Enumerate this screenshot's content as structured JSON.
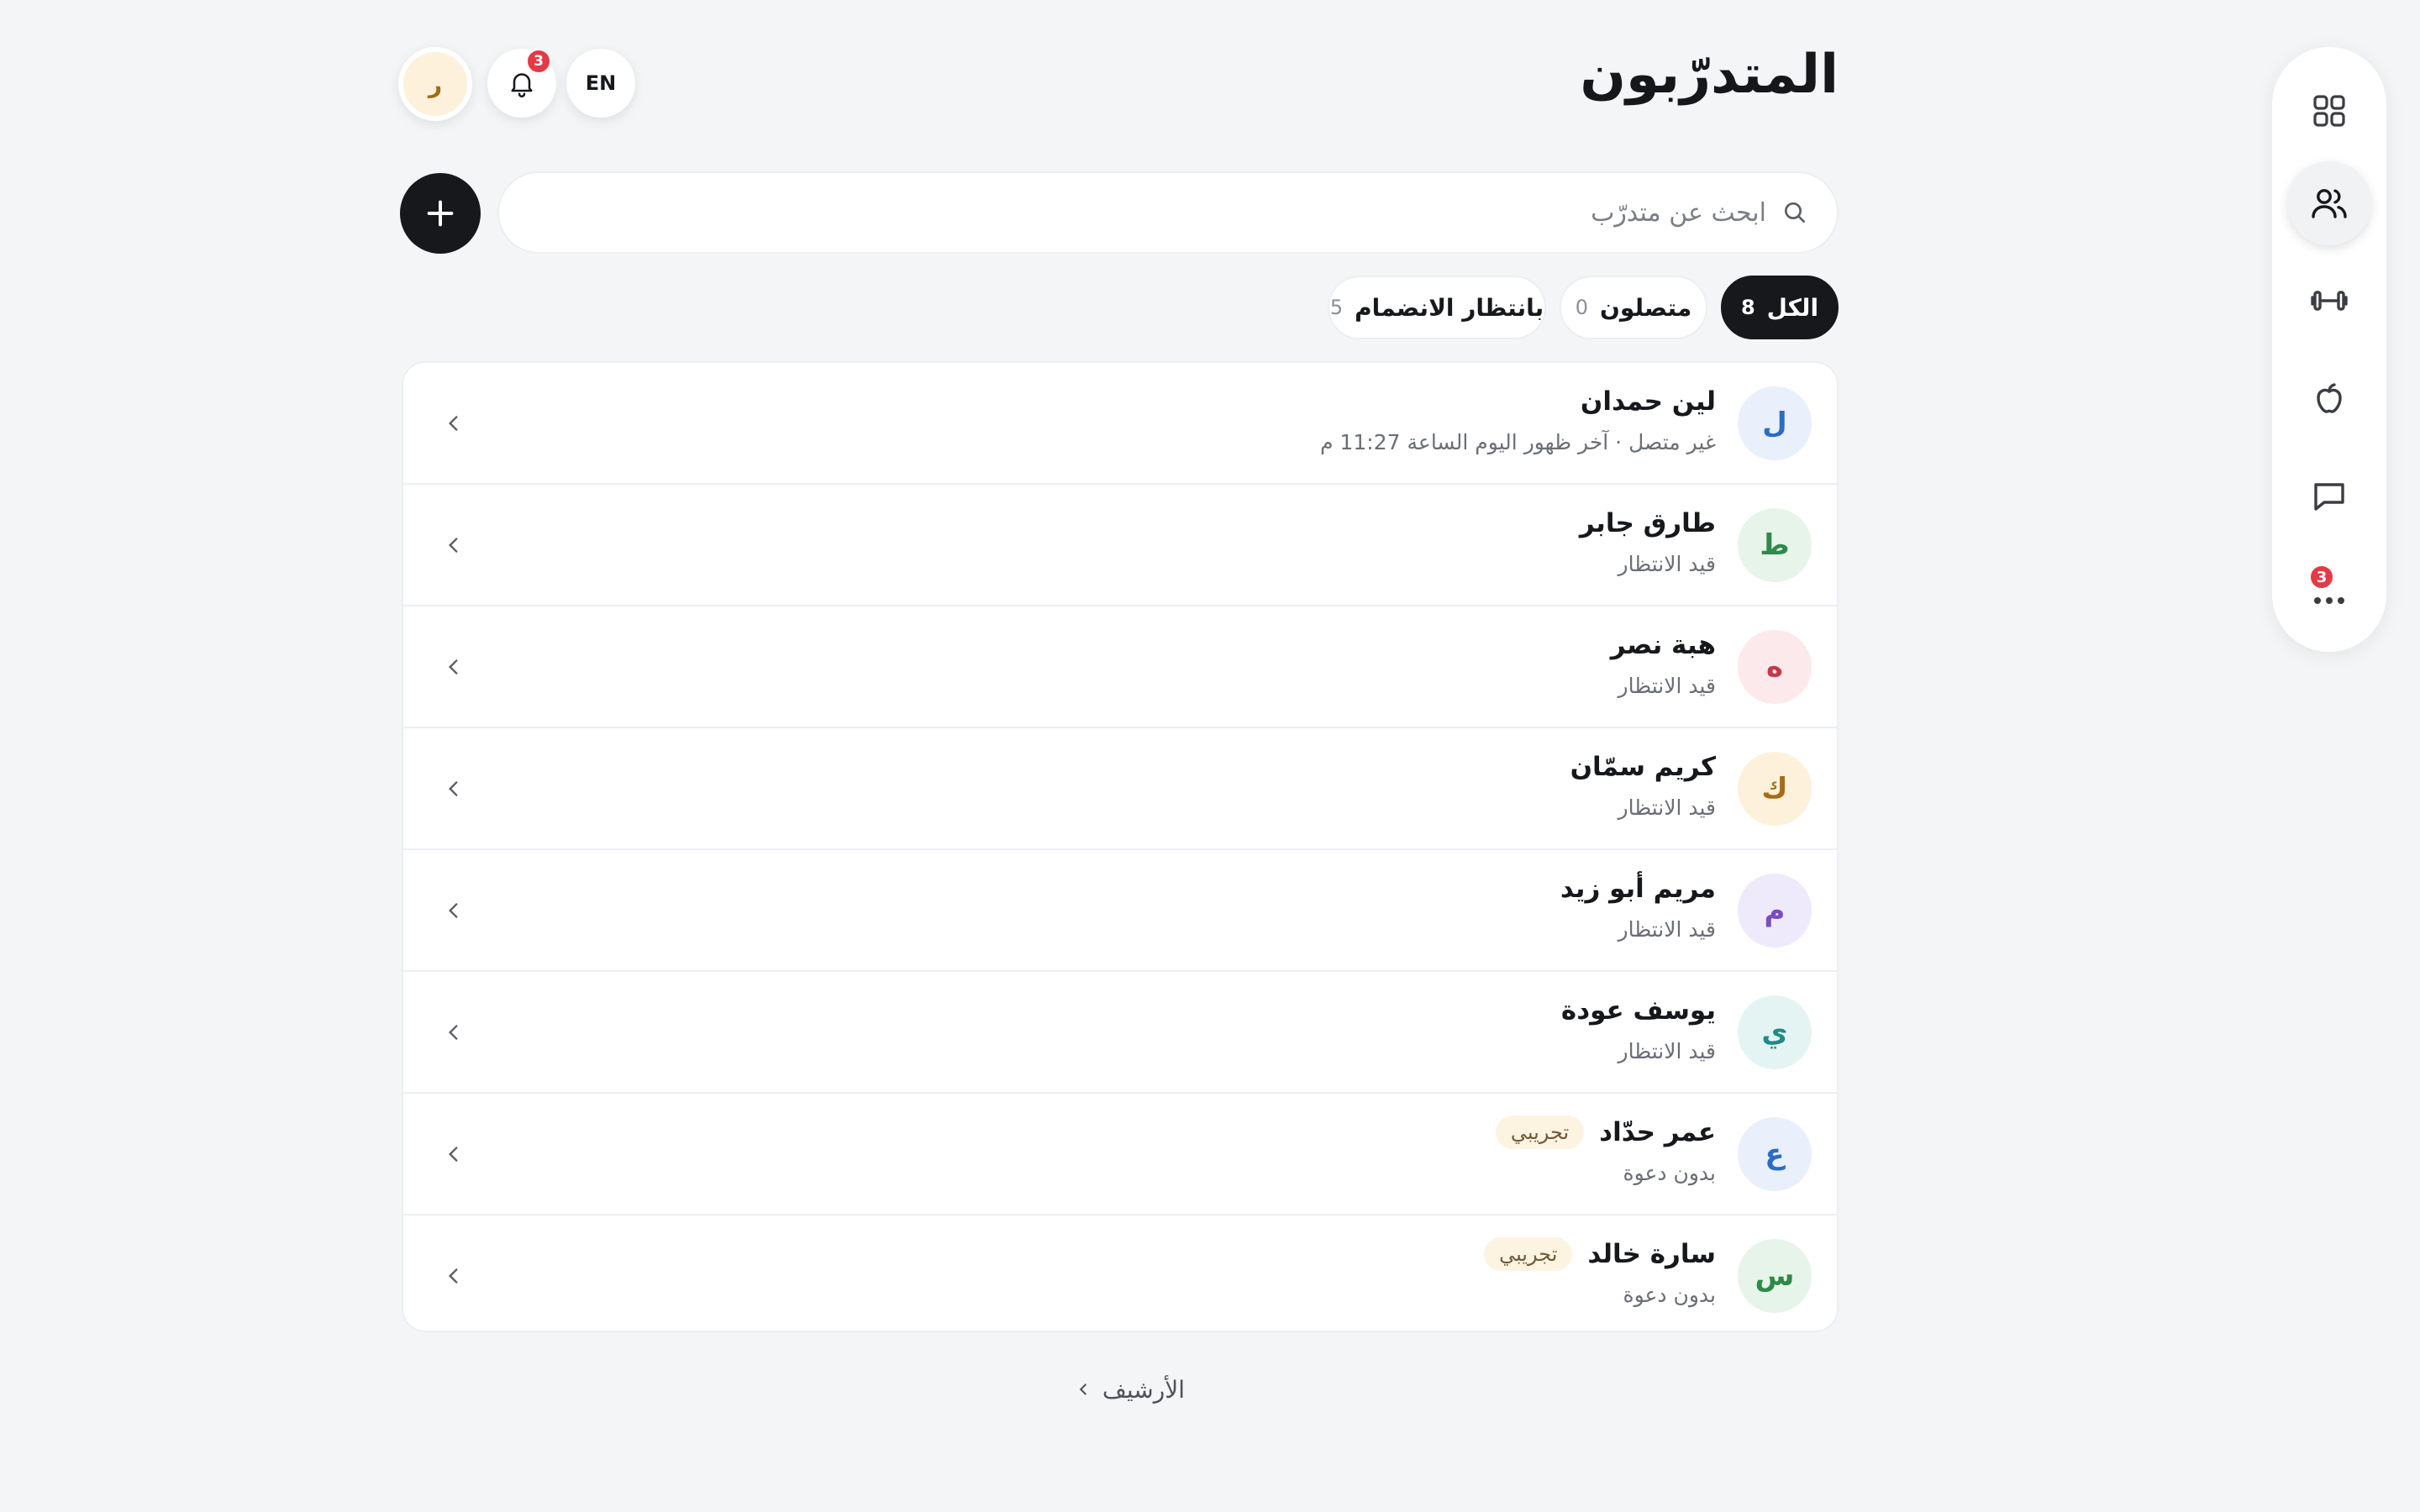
{
  "header": {
    "title": "المتدرّبون",
    "language_label": "EN",
    "notifications_count": "3",
    "avatar_initial": "ر"
  },
  "search": {
    "placeholder": "ابحث عن متدرّب",
    "value": ""
  },
  "filters": [
    {
      "label": "الكل",
      "count": "8",
      "active": true
    },
    {
      "label": "متصلون",
      "count": "0",
      "active": false
    },
    {
      "label": "بانتظار الانضمام",
      "count": "5",
      "active": false
    }
  ],
  "trainees": [
    {
      "initial": "ل",
      "name": "لين حمدان",
      "status": "غير متصل · آخر ظهور اليوم الساعة 11:27 م",
      "tag": "",
      "color": "#2b6cc4",
      "bg": "#e9effb"
    },
    {
      "initial": "ط",
      "name": "طارق جابر",
      "status": "قيد الانتظار",
      "tag": "",
      "color": "#2e8a4a",
      "bg": "#e6f4ea"
    },
    {
      "initial": "ه",
      "name": "هبة نصر",
      "status": "قيد الانتظار",
      "tag": "",
      "color": "#c23a4a",
      "bg": "#fbe9eb"
    },
    {
      "initial": "ك",
      "name": "كريم سمّان",
      "status": "قيد الانتظار",
      "tag": "",
      "color": "#a86b16",
      "bg": "#fdf1dc"
    },
    {
      "initial": "م",
      "name": "مريم أبو زيد",
      "status": "قيد الانتظار",
      "tag": "",
      "color": "#7a4cc2",
      "bg": "#efeafb"
    },
    {
      "initial": "ي",
      "name": "يوسف عودة",
      "status": "قيد الانتظار",
      "tag": "",
      "color": "#1f8a86",
      "bg": "#e4f4f2"
    },
    {
      "initial": "ع",
      "name": "عمر حدّاد",
      "status": "بدون دعوة",
      "tag": "تجريبي",
      "color": "#2b6cc4",
      "bg": "#e9effb"
    },
    {
      "initial": "س",
      "name": "سارة خالد",
      "status": "بدون دعوة",
      "tag": "تجريبي",
      "color": "#2e8a4a",
      "bg": "#e6f4ea"
    }
  ],
  "archive": {
    "label": "الأرشيف"
  },
  "rail": {
    "items": [
      {
        "icon": "dashboard-grid-icon"
      },
      {
        "icon": "users-icon",
        "active": true
      },
      {
        "icon": "dumbbell-icon"
      },
      {
        "icon": "apple-icon"
      },
      {
        "icon": "chat-bubble-icon"
      },
      {
        "icon": "more-icon",
        "badge": "3"
      }
    ]
  },
  "colors": {
    "background": "#f4f5f7",
    "primary_dark": "#16181c",
    "badge_red": "#e53945",
    "tag_bg": "#fdf3e1"
  }
}
